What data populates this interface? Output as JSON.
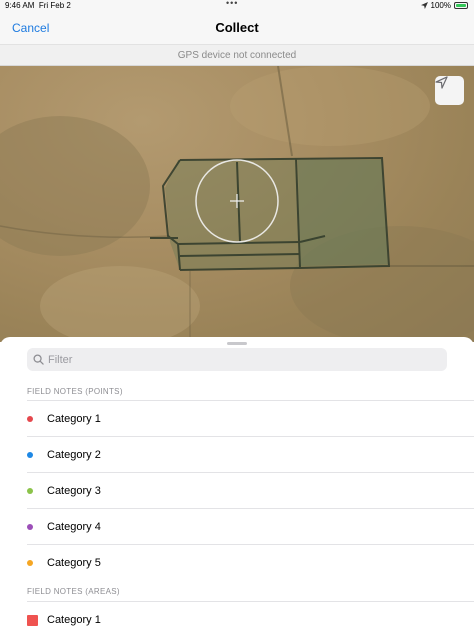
{
  "status_bar": {
    "time": "9:46 AM",
    "date": "Fri Feb 2",
    "battery": "100%"
  },
  "nav": {
    "cancel_label": "Cancel",
    "title": "Collect"
  },
  "gps_banner": "GPS device not connected",
  "map": {
    "locate_icon": "location-arrow-icon"
  },
  "search": {
    "placeholder": "Filter"
  },
  "sections": [
    {
      "header": "FIELD NOTES (POINTS)",
      "items": [
        {
          "label": "Category 1",
          "color": "#e5484d",
          "shape": "dot"
        },
        {
          "label": "Category 2",
          "color": "#1e88e5",
          "shape": "dot"
        },
        {
          "label": "Category 3",
          "color": "#8bc34a",
          "shape": "dot"
        },
        {
          "label": "Category 4",
          "color": "#9c4fb8",
          "shape": "dot"
        },
        {
          "label": "Category 5",
          "color": "#f5a623",
          "shape": "dot"
        }
      ]
    },
    {
      "header": "FIELD NOTES (AREAS)",
      "items": [
        {
          "label": "Category 1",
          "color": "#ef5350",
          "shape": "square"
        }
      ]
    }
  ]
}
